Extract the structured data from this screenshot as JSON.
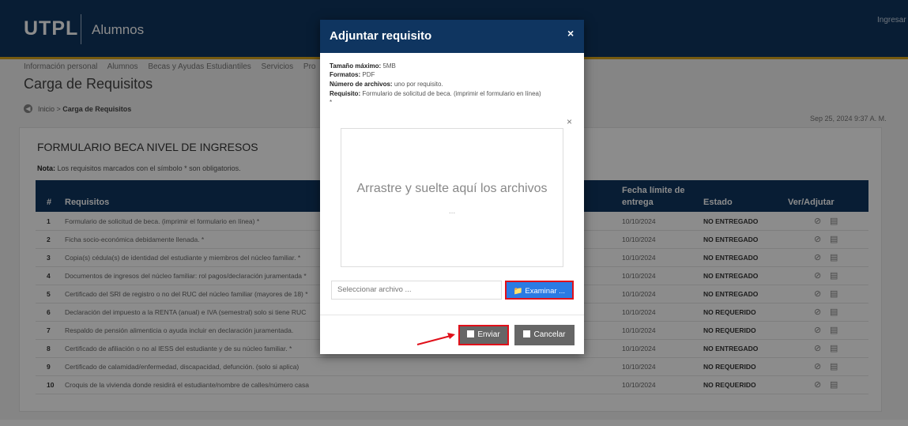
{
  "header": {
    "logo": "UTPL",
    "app_name": "Alumnos",
    "login": "Ingresar"
  },
  "nav": {
    "items": [
      "Información personal",
      "Alumnos",
      "Becas y Ayudas Estudiantiles",
      "Servicios",
      "Pro"
    ]
  },
  "page": {
    "title": "Carga de Requisitos",
    "breadcrumb_home": "Inicio",
    "breadcrumb_current": "Carga de Requisitos",
    "datetime": "Sep 25, 2024 9:37 A. M."
  },
  "form": {
    "title": "FORMULARIO BECA NIVEL DE INGRESOS",
    "note_label": "Nota:",
    "note_text": "Los requisitos marcados con el símbolo * son obligatorios.",
    "columns": {
      "num": "#",
      "requisitos": "Requisitos",
      "fecha": "Fecha límite de entrega",
      "estado": "Estado",
      "ver": "Ver/Adjutar"
    },
    "rows": [
      {
        "n": "1",
        "req": "Formulario de solicitud de beca. (imprimir el formulario en línea) *",
        "fecha": "10/10/2024",
        "estado": "NO ENTREGADO"
      },
      {
        "n": "2",
        "req": "Ficha socio-económica debidamente llenada. *",
        "fecha": "10/10/2024",
        "estado": "NO ENTREGADO"
      },
      {
        "n": "3",
        "req": "Copia(s) cédula(s) de identidad del estudiante y miembros del núcleo familiar. *",
        "fecha": "10/10/2024",
        "estado": "NO ENTREGADO"
      },
      {
        "n": "4",
        "req": "Documentos de ingresos del núcleo familiar: rol pagos/declaración juramentada *",
        "fecha": "10/10/2024",
        "estado": "NO ENTREGADO"
      },
      {
        "n": "5",
        "req": "Certificado del SRI de registro o no del RUC del núcleo familiar (mayores de 18) *",
        "fecha": "10/10/2024",
        "estado": "NO ENTREGADO"
      },
      {
        "n": "6",
        "req": "Declaración del impuesto a la RENTA (anual) e IVA (semestral) solo si tiene RUC",
        "fecha": "10/10/2024",
        "estado": "NO REQUERIDO"
      },
      {
        "n": "7",
        "req": "Respaldo de pensión alimenticia o ayuda incluir en declaración juramentada.",
        "fecha": "10/10/2024",
        "estado": "NO REQUERIDO"
      },
      {
        "n": "8",
        "req": "Certificado de afiliación o no al IESS del estudiante y de su núcleo familiar. *",
        "fecha": "10/10/2024",
        "estado": "NO ENTREGADO"
      },
      {
        "n": "9",
        "req": "Certificado de calamidad/enfermedad, discapacidad, defunción. (solo si aplica)",
        "fecha": "10/10/2024",
        "estado": "NO REQUERIDO"
      },
      {
        "n": "10",
        "req": "Croquis de la vivienda donde residirá el estudiante/nombre de calles/número casa",
        "fecha": "10/10/2024",
        "estado": "NO REQUERIDO"
      }
    ]
  },
  "modal": {
    "title": "Adjuntar requisito",
    "close": "×",
    "size_label": "Tamaño máximo:",
    "size_value": "5MB",
    "formats_label": "Formatos:",
    "formats_value": "PDF",
    "files_label": "Número de archivos:",
    "files_value": "uno por requisito.",
    "req_label": "Requisito:",
    "req_value": "Formulario de solicitud de beca. (imprimir el formulario en línea)",
    "req_star": "*",
    "drop_close": "×",
    "drop_text": "Arrastre y suelte aquí los archivos",
    "drop_dots": "...",
    "file_placeholder": "Seleccionar archivo ...",
    "browse": "Examinar ...",
    "send": "Enviar",
    "cancel": "Cancelar"
  },
  "colors": {
    "primary": "#0f3560",
    "accent": "#d7a51d",
    "browse": "#2a7be4",
    "highlight": "#e0101a",
    "button_gray": "#666666"
  }
}
